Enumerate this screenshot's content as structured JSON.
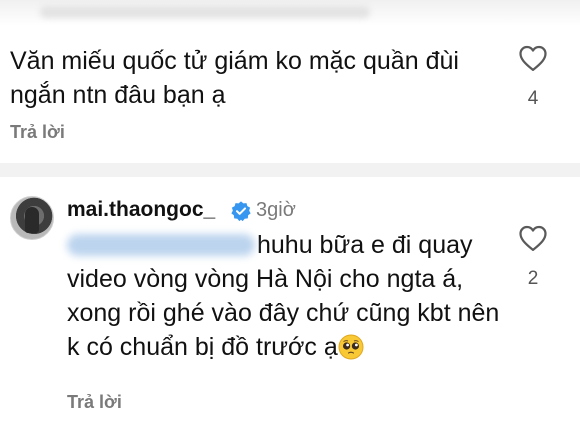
{
  "comment1": {
    "text": "Văn miếu quốc tử giám ko mặc quần đùi ngắn ntn đâu bạn ạ",
    "likes": "4",
    "reply_label": "Trả lời"
  },
  "comment2": {
    "username": "mai.thaongoc_",
    "time": "3giờ",
    "text": "huhu bữa e đi quay video vòng vòng Hà Nội cho ngta á, xong rồi ghé vào đây chứ cũng kbt nên k có chuẩn bị đồ trước ạ",
    "likes": "2",
    "reply_label": "Trả lời"
  },
  "icons": {
    "like": "heart-icon",
    "verified": "verified-badge-icon",
    "emoji": "pleading-face-emoji"
  },
  "colors": {
    "verified": "#3797f0",
    "muted": "#7a7a7a"
  }
}
